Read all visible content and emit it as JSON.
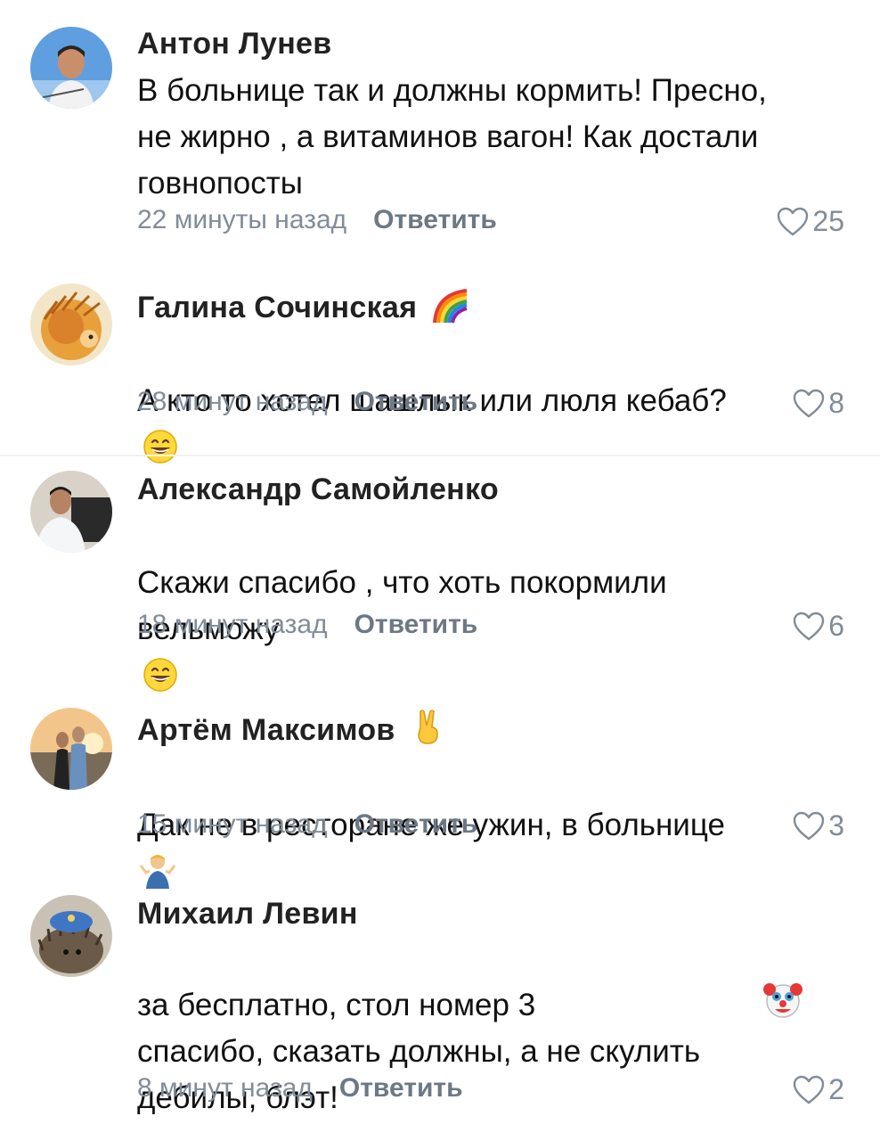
{
  "comments": [
    {
      "author": "Антон Лунев",
      "text": "В больнице так и должны кормить! Пресно,\nне жирно , а витаминов вагон! Как достали\nговнопосты",
      "time": "22 минуты назад",
      "reply": "Ответить",
      "likes": "25",
      "avatar_icon": "avatar-photo-icon"
    },
    {
      "author": "Галина Сочинская",
      "text": "А кто то хотел шашлык или люля кебаб?",
      "time": "28 минут назад",
      "reply": "Ответить",
      "likes": "8",
      "badge_icon": "rainbow-icon",
      "avatar_icon": "avatar-photo-icon"
    },
    {
      "author": "Александр Самойленко",
      "text": "Скажи спасибо , что хоть покормили\nвельможу",
      "time": "18 минут назад",
      "reply": "Ответить",
      "likes": "6",
      "avatar_icon": "avatar-photo-icon"
    },
    {
      "author": "Артём Максимов",
      "text": "Дак не в ресторане же ужин, в больнице",
      "time": "15 минут назад",
      "reply": "Ответить",
      "likes": "3",
      "badge_icon": "victory-hand-icon",
      "avatar_icon": "avatar-photo-icon"
    },
    {
      "author": "Михаил Левин",
      "text": "за бесплатно, стол номер 3\nспасибо, сказать должны, а не скулить\nдебилы, блэт!",
      "time": "8 минут назад",
      "reply": "Ответить",
      "likes": "2",
      "avatar_icon": "avatar-photo-icon"
    }
  ],
  "colors": {
    "meta": "#818c99",
    "reply": "#6d7885",
    "divider": "#f2f2f4"
  }
}
